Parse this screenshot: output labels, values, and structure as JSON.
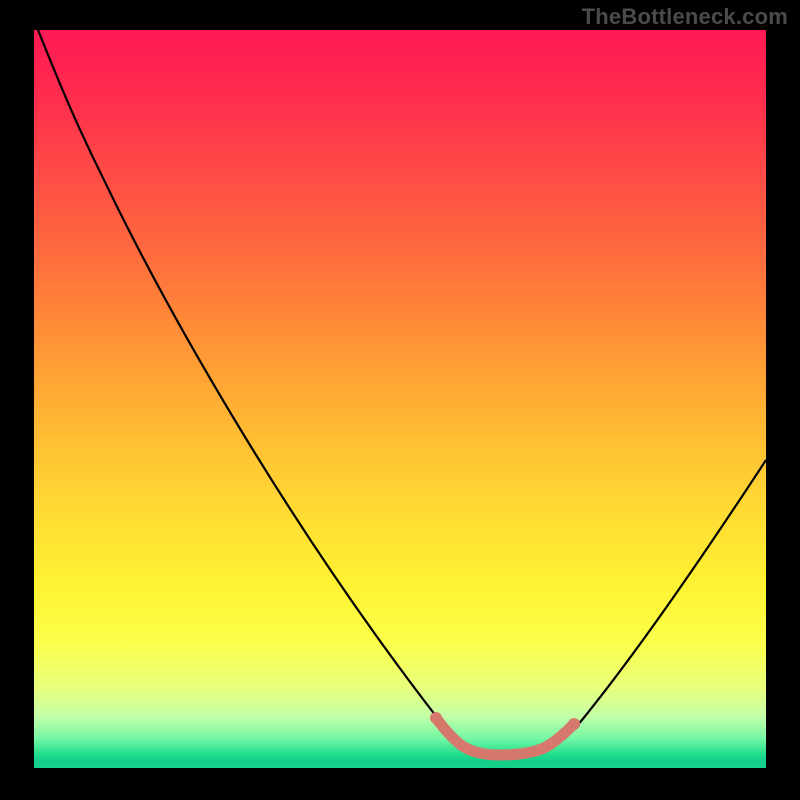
{
  "watermark": "TheBottleneck.com",
  "chart_data": {
    "type": "line",
    "title": "",
    "xlabel": "",
    "ylabel": "",
    "xlim": [
      0,
      1
    ],
    "ylim": [
      0,
      1
    ],
    "series": [
      {
        "name": "curve",
        "x": [
          0.0,
          0.03,
          0.08,
          0.15,
          0.25,
          0.35,
          0.45,
          0.52,
          0.57,
          0.6,
          0.63,
          0.67,
          0.72,
          0.78,
          0.85,
          0.92,
          1.0
        ],
        "y": [
          1.0,
          0.94,
          0.83,
          0.7,
          0.53,
          0.36,
          0.19,
          0.08,
          0.03,
          0.01,
          0.01,
          0.01,
          0.02,
          0.06,
          0.14,
          0.26,
          0.42
        ]
      }
    ],
    "accent_region": {
      "x_start": 0.55,
      "x_end": 0.73
    },
    "background_gradient": [
      "#ff1a55",
      "#ff4747",
      "#ff9236",
      "#ffd833",
      "#fff233",
      "#e9ff7a",
      "#74f7a6",
      "#17d08b"
    ]
  }
}
